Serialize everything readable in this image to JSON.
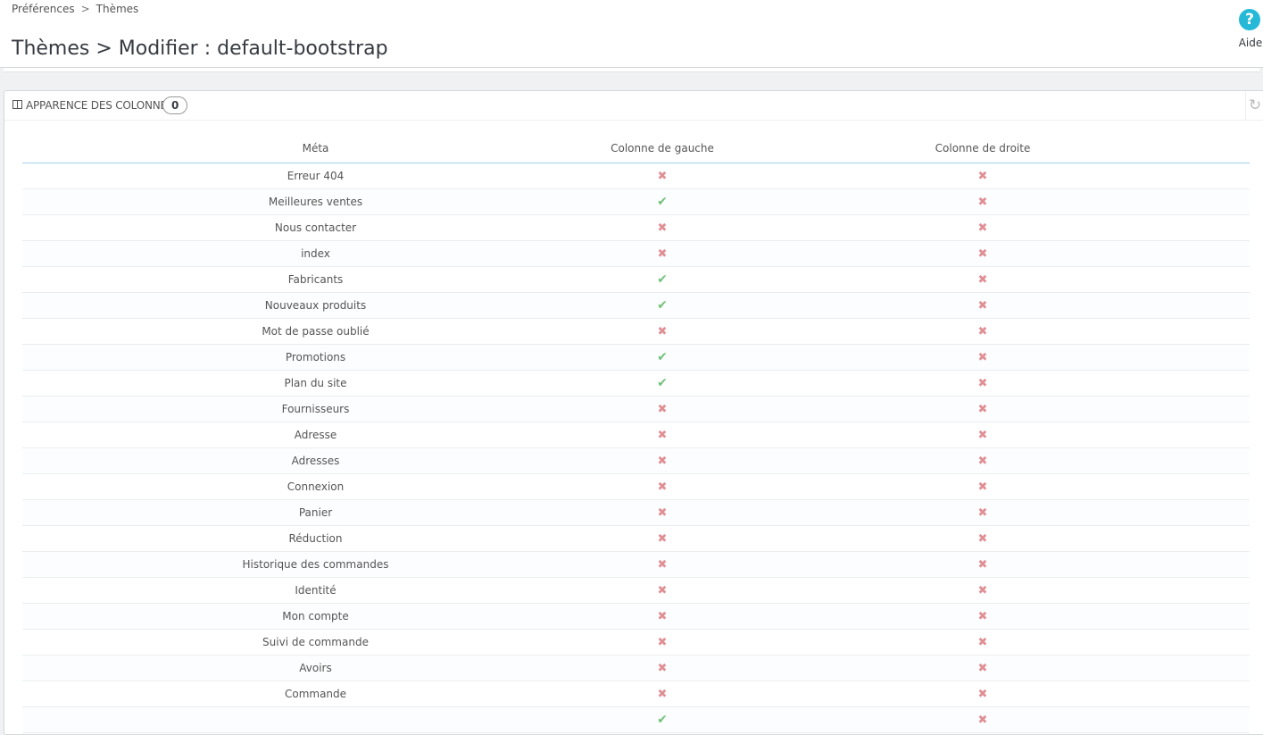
{
  "breadcrumb": {
    "parent": "Préférences",
    "separator": ">",
    "current": "Thèmes"
  },
  "page_title": "Thèmes > Modifier : default-bootstrap",
  "help": {
    "label": "Aide",
    "icon": "question-circle-icon"
  },
  "panel": {
    "title": "APPARENCE DES COLONNES",
    "badge": "0",
    "refresh_icon": "refresh-icon"
  },
  "table": {
    "headers": [
      "Méta",
      "Colonne de gauche",
      "Colonne de droite"
    ],
    "rows": [
      {
        "meta": "Erreur 404",
        "left": false,
        "right": false
      },
      {
        "meta": "Meilleures ventes",
        "left": true,
        "right": false
      },
      {
        "meta": "Nous contacter",
        "left": false,
        "right": false
      },
      {
        "meta": "index",
        "left": false,
        "right": false
      },
      {
        "meta": "Fabricants",
        "left": true,
        "right": false
      },
      {
        "meta": "Nouveaux produits",
        "left": true,
        "right": false
      },
      {
        "meta": "Mot de passe oublié",
        "left": false,
        "right": false
      },
      {
        "meta": "Promotions",
        "left": true,
        "right": false
      },
      {
        "meta": "Plan du site",
        "left": true,
        "right": false
      },
      {
        "meta": "Fournisseurs",
        "left": false,
        "right": false
      },
      {
        "meta": "Adresse",
        "left": false,
        "right": false
      },
      {
        "meta": "Adresses",
        "left": false,
        "right": false
      },
      {
        "meta": "Connexion",
        "left": false,
        "right": false
      },
      {
        "meta": "Panier",
        "left": false,
        "right": false
      },
      {
        "meta": "Réduction",
        "left": false,
        "right": false
      },
      {
        "meta": "Historique des commandes",
        "left": false,
        "right": false
      },
      {
        "meta": "Identité",
        "left": false,
        "right": false
      },
      {
        "meta": "Mon compte",
        "left": false,
        "right": false
      },
      {
        "meta": "Suivi de commande",
        "left": false,
        "right": false
      },
      {
        "meta": "Avoirs",
        "left": false,
        "right": false
      },
      {
        "meta": "Commande",
        "left": false,
        "right": false
      },
      {
        "meta": "",
        "left": true,
        "right": false
      }
    ]
  },
  "colors": {
    "enabled": "#72c279",
    "disabled": "#e08f95",
    "accent": "#25b9d7"
  }
}
